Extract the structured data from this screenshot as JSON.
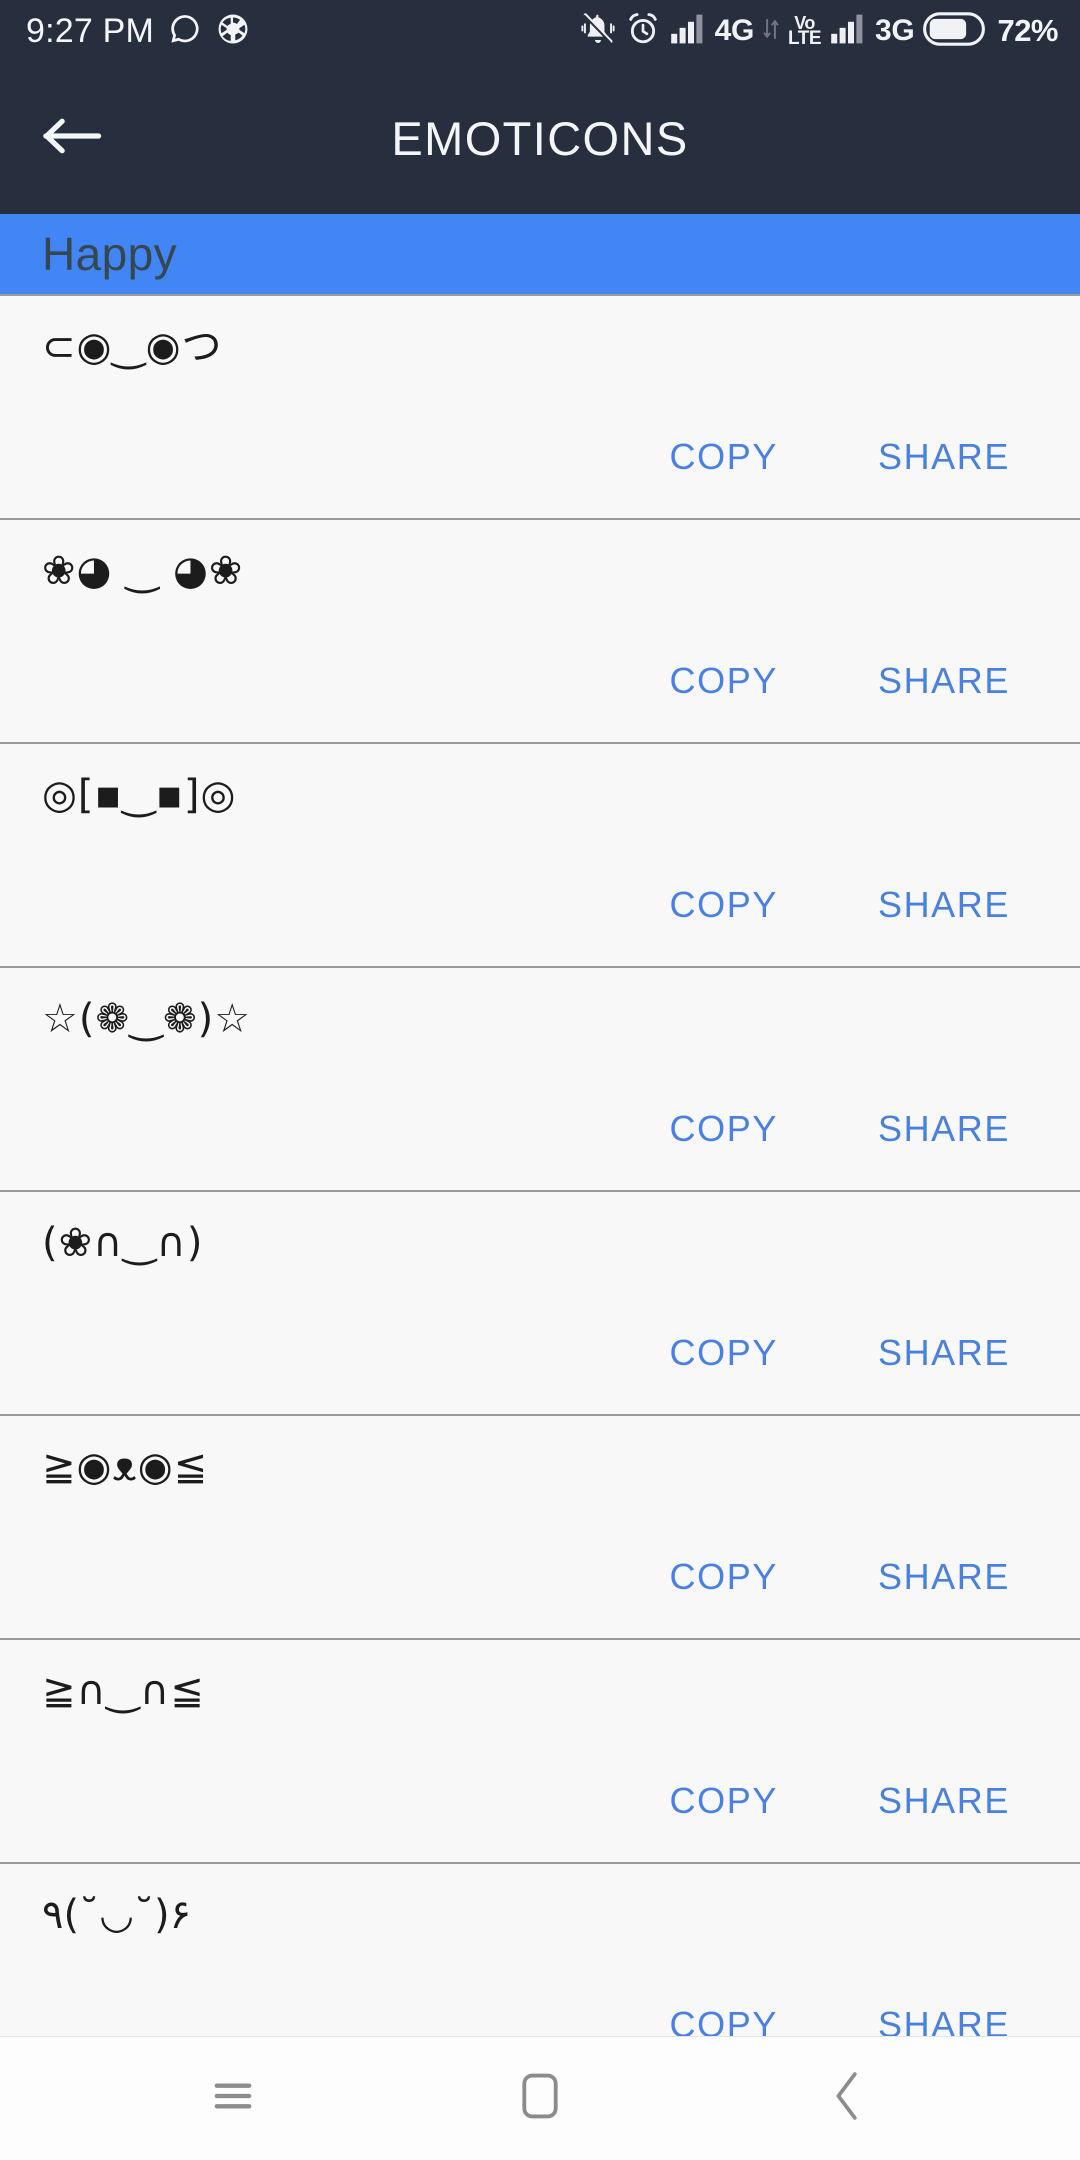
{
  "status_bar": {
    "time": "9:27 PM",
    "left_icons": [
      "whatsapp-icon",
      "app-circle-icon"
    ],
    "right_icons": [
      "bell-muted-icon",
      "alarm-icon",
      "signal-bars-icon",
      "volte-icon",
      "signal-bars-2-icon",
      "battery-icon"
    ],
    "network_primary": "4G",
    "volte_top": "Vo",
    "volte_bottom": "LTE",
    "network_secondary": "3G",
    "battery_percent": "72%",
    "background_color": "#272e3e"
  },
  "app_bar": {
    "title": "EMOTICONS",
    "back_icon": "arrow-left-icon",
    "background_color": "#272e3e"
  },
  "category": {
    "label": "Happy",
    "background_color": "#4285f4",
    "text_color": "#37474f"
  },
  "actions": {
    "copy_label": "COPY",
    "share_label": "SHARE",
    "accent_color": "#4a80e0"
  },
  "emoticons": [
    {
      "text": "⊂◉‿◉つ"
    },
    {
      "text": "❀◕ ‿ ◕❀"
    },
    {
      "text": "◎[▪‿▪]◎"
    },
    {
      "text": "☆(❁‿❁)☆"
    },
    {
      "text": "(❀∩‿∩)"
    },
    {
      "text": "≧◉ᴥ◉≦"
    },
    {
      "text": "≧∩‿∩≦"
    },
    {
      "text": "٩(˘◡˘)۶"
    }
  ],
  "nav_bar": {
    "menu_icon": "menu-icon",
    "home_icon": "home-square-icon",
    "back_icon": "chevron-left-icon"
  }
}
